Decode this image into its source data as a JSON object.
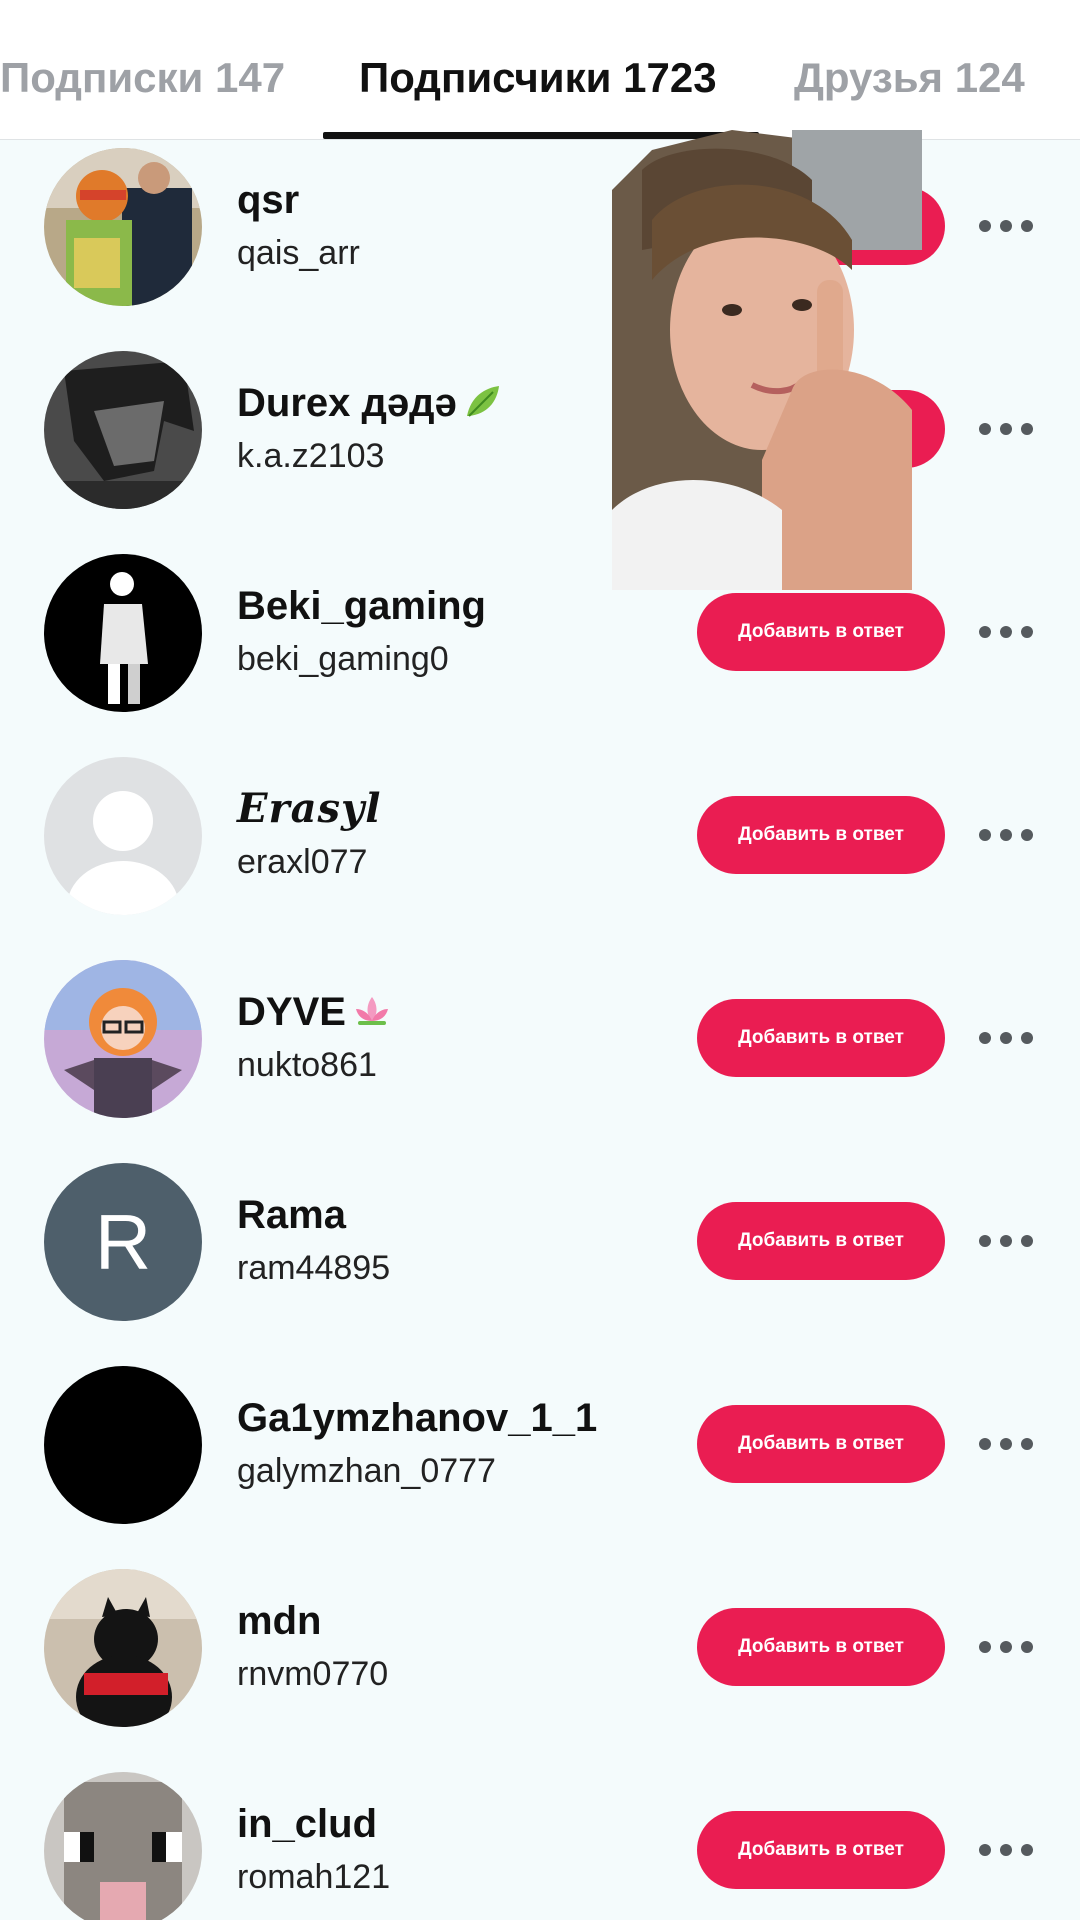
{
  "tabs": [
    {
      "label": "Подписки 147",
      "active": false
    },
    {
      "label": "Подписчики 1723",
      "active": true
    },
    {
      "label": "Друзья 124",
      "active": false
    }
  ],
  "reply_button_label": "Добавить в ответ",
  "colors": {
    "accent": "#ea1d52",
    "background": "#f4fbfc"
  },
  "followers": [
    {
      "display_name": "qsr",
      "username": "qais_arr",
      "avatar": "photo-man-with-turtle-mascot"
    },
    {
      "display_name": "Durex дәдә",
      "emoji": "leaf-emoji",
      "username": "k.a.z2103",
      "avatar": "anime-boy-dark"
    },
    {
      "display_name": "Beki_gaming",
      "username": "beki_gaming0",
      "avatar": "anime-figure-black"
    },
    {
      "display_name": "Erasyl",
      "username": "eraxl077",
      "avatar": "default-avatar"
    },
    {
      "display_name": "DYVE",
      "emoji": "lotus-emoji",
      "username": "nukto861",
      "avatar": "anime-girl-glasses"
    },
    {
      "display_name": "Rama",
      "username": "ram44895",
      "avatar": "letter-avatar",
      "avatar_letter": "R"
    },
    {
      "display_name": "Ga1ymzhanov_1_1",
      "username": "galymzhan_0777",
      "avatar": "black-avatar"
    },
    {
      "display_name": "mdn",
      "username": "rnvm0770",
      "avatar": "black-cat-photo"
    },
    {
      "display_name": "in_clud",
      "username": "romah121",
      "avatar": "pixel-sheep"
    }
  ],
  "overlay": {
    "description_icon": "shushing-boy-photo"
  }
}
